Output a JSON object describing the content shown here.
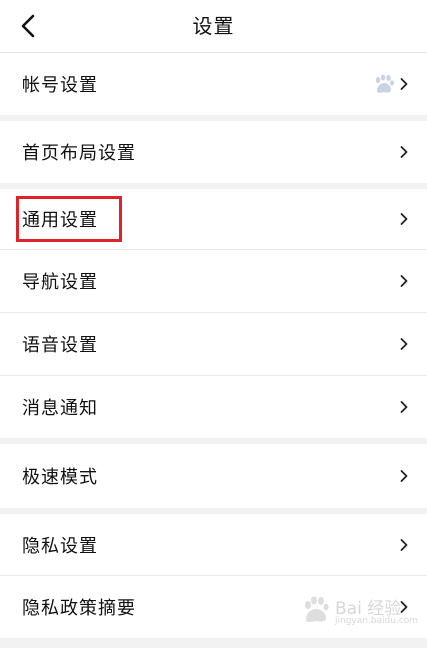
{
  "header": {
    "title": "设置",
    "back_icon": "chevron-left-icon"
  },
  "settings": [
    {
      "id": "account",
      "label": "帐号设置",
      "badge_icon": "baidu-paw-icon"
    },
    {
      "id": "home-layout",
      "label": "首页布局设置"
    },
    {
      "id": "general",
      "label": "通用设置",
      "highlighted": true
    },
    {
      "id": "navigation",
      "label": "导航设置"
    },
    {
      "id": "voice",
      "label": "语音设置"
    },
    {
      "id": "notifications",
      "label": "消息通知"
    },
    {
      "id": "speed-mode",
      "label": "极速模式"
    },
    {
      "id": "privacy",
      "label": "隐私设置"
    },
    {
      "id": "privacy-policy",
      "label": "隐私政策摘要"
    }
  ],
  "watermark": {
    "text": "Bai 经验",
    "sub": "jingyan.baidu.com"
  },
  "colors": {
    "highlight": "#e0232a",
    "background": "#f2f2f2"
  }
}
